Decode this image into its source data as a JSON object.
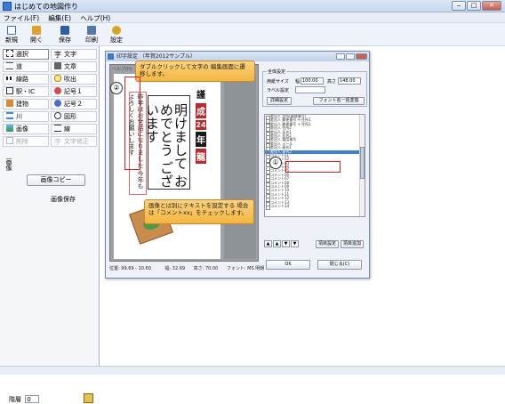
{
  "app": {
    "title": "はじめての地図作り"
  },
  "menu": [
    "ファイル(F)",
    "編集(E)",
    "ヘルプ(H)"
  ],
  "toolbar": [
    {
      "label": "新規",
      "icon": "new-file-icon",
      "color": "#3b6db8"
    },
    {
      "label": "開く",
      "icon": "open-folder-icon",
      "color": "#e0a32a"
    },
    {
      "label": "保存",
      "icon": "save-icon",
      "color": "#2f5fa8"
    },
    {
      "label": "印刷",
      "icon": "print-icon",
      "color": "#5577aa"
    },
    {
      "label": "設定",
      "icon": "settings-gear-icon",
      "color": "#d9a21c"
    }
  ],
  "tools": [
    {
      "label": "選択",
      "icon": "select-icon",
      "selected": true
    },
    {
      "label": "文字",
      "icon": "text-icon"
    },
    {
      "label": "道",
      "icon": "road-icon"
    },
    {
      "label": "文章",
      "icon": "paragraph-icon"
    },
    {
      "label": "線路",
      "icon": "railway-icon"
    },
    {
      "label": "吹出",
      "icon": "balloon-icon"
    },
    {
      "label": "駅・IC",
      "icon": "station-icon"
    },
    {
      "label": "記号１",
      "icon": "symbol1-icon"
    },
    {
      "label": "建物",
      "icon": "building-icon"
    },
    {
      "label": "記号２",
      "icon": "symbol2-icon"
    },
    {
      "label": "川",
      "icon": "river-icon"
    },
    {
      "label": "図形",
      "icon": "shape-icon"
    },
    {
      "label": "画像",
      "icon": "image-icon"
    },
    {
      "label": "線",
      "icon": "line-icon"
    },
    {
      "label": "削除",
      "icon": "delete-icon",
      "disabled": true
    },
    {
      "label": "文字修正",
      "icon": "text-edit-icon",
      "disabled": true
    }
  ],
  "side_tab": "画像",
  "side_buttons": {
    "copy": "画像コピー",
    "save": "画像保存"
  },
  "layer": {
    "label": "階層",
    "value": "0"
  },
  "dialog": {
    "title": "印字設定 （年賀2012サンプル）",
    "preview_toolbar": "ヘルプ(H)",
    "card_text": "明けまして おめでとう ございます",
    "message_text": "昨年はお世話になりました 今年もよろしくお願いします",
    "stamp": [
      "謹",
      "成",
      "24",
      "年",
      "龍"
    ],
    "status": {
      "position": "位置: 99.69 - 10.60",
      "width": "幅: 32.69",
      "height": "高さ: 70.00",
      "font": "フォント: MS 明朝"
    },
    "settings": {
      "group_label": "全体設定",
      "paper_size_label": "用紙サイズ",
      "width_label": "幅",
      "width_value": "100.00",
      "height_label": "高さ",
      "height_value": "148.00",
      "label_setting": "ラベル設定",
      "detail_button": "詳細設定",
      "font_button": "フォント名一括変換"
    },
    "list_items": [
      "差出人 住所(郵便番号)",
      "差出人 郵便番号 + 住所1",
      "差出人 郵便番号 + 住所1",
      "差出人 住所2",
      "差出人 氏名1",
      "差出人 氏名2",
      "差出人 電話番号",
      "差出人 メール",
      "差出人 連名1",
      "差出人 連名2",
      "コメント01",
      "コメント02",
      "コメント03",
      "コメント04",
      "コメント05",
      "コメント06",
      "コメント07",
      "コメント08",
      "コメント09",
      "コメント10",
      "コメント11",
      "コメント12",
      "コメント13",
      "コメント14"
    ],
    "selected_index": 9,
    "arrows": [
      "▲",
      "▲",
      "▼",
      "▼"
    ],
    "item_setting_button": "項目設定",
    "item_add_button": "項目追加",
    "ok_button": "OK",
    "close_button": "閉じる(C)"
  },
  "callouts": {
    "top": "ダブルクリックして文字の 編集画面に遷移します。",
    "bottom": "画像とは別にテキストを設定する 場合は「コメントxx」をチェックします。",
    "num1": "①",
    "num2": "②"
  }
}
